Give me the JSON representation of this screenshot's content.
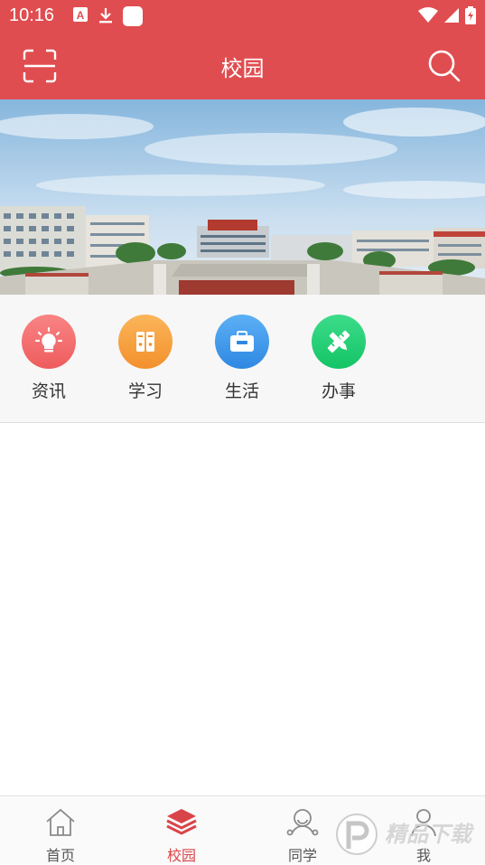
{
  "status_bar": {
    "time": "10:16"
  },
  "header": {
    "title": "校园"
  },
  "quick_actions": [
    {
      "label": "资讯",
      "icon": "lightbulb-icon",
      "color": "#f36a6c"
    },
    {
      "label": "学习",
      "icon": "binders-icon",
      "color": "#f7a13c"
    },
    {
      "label": "生活",
      "icon": "briefcase-icon",
      "color": "#3f99ec"
    },
    {
      "label": "办事",
      "icon": "pencil-ruler-icon",
      "color": "#1fcf73"
    }
  ],
  "tabs": [
    {
      "label": "首页",
      "icon": "home-icon",
      "active": false
    },
    {
      "label": "校园",
      "icon": "layers-icon",
      "active": true
    },
    {
      "label": "同学",
      "icon": "classmates-icon",
      "active": false
    },
    {
      "label": "我",
      "icon": "user-icon",
      "active": false
    }
  ],
  "colors": {
    "brand": "#e04d50",
    "active_tab": "#d94448"
  }
}
